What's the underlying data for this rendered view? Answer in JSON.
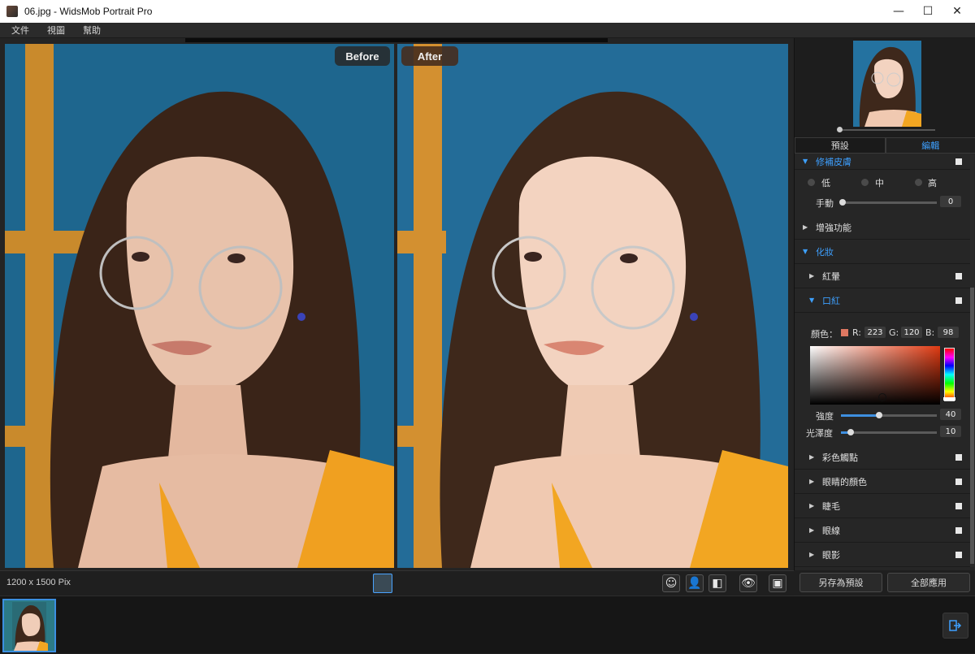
{
  "window": {
    "title": "06.jpg - WidsMob Portrait Pro",
    "minimize": "—",
    "maximize": "☐",
    "close": "✕"
  },
  "menu": {
    "items": [
      "文件",
      "視圖",
      "幫助"
    ]
  },
  "compare": {
    "before_label": "Before",
    "after_label": "After"
  },
  "status": {
    "dimensions": "1200 x 1500 Pix"
  },
  "toolbar": {
    "face_icon": "☺",
    "person_icon": "👤",
    "split_icon": "◧",
    "eye_icon": "👁",
    "frame_icon": "▣"
  },
  "panel": {
    "tabs": [
      "預設",
      "編輯"
    ],
    "active_tab": 1,
    "smooth_skin": {
      "label": "修補皮膚",
      "levels": [
        "低",
        "中",
        "高"
      ],
      "manual_label": "手動",
      "manual_value": "0"
    },
    "enhance": {
      "label": "增強功能"
    },
    "makeup": {
      "label": "化妝"
    },
    "blush": {
      "label": "紅暈"
    },
    "lipstick": {
      "label": "口紅",
      "color_label": "顏色：",
      "r_label": "R:",
      "r": "223",
      "g_label": "G:",
      "g": "120",
      "b_label": "B:",
      "b": "98",
      "swatch_color": "#df7862",
      "intensity_label": "強度",
      "intensity": "40",
      "gloss_label": "光澤度",
      "gloss": "10"
    },
    "sections": [
      "彩色觸點",
      "眼睛的顏色",
      "睫毛",
      "眼線",
      "眼影"
    ]
  },
  "buttons": {
    "save_preset": "另存為預設",
    "apply_all": "全部應用"
  },
  "colors": {
    "accent": "#3ea0ff",
    "panel_bg": "#262626"
  }
}
